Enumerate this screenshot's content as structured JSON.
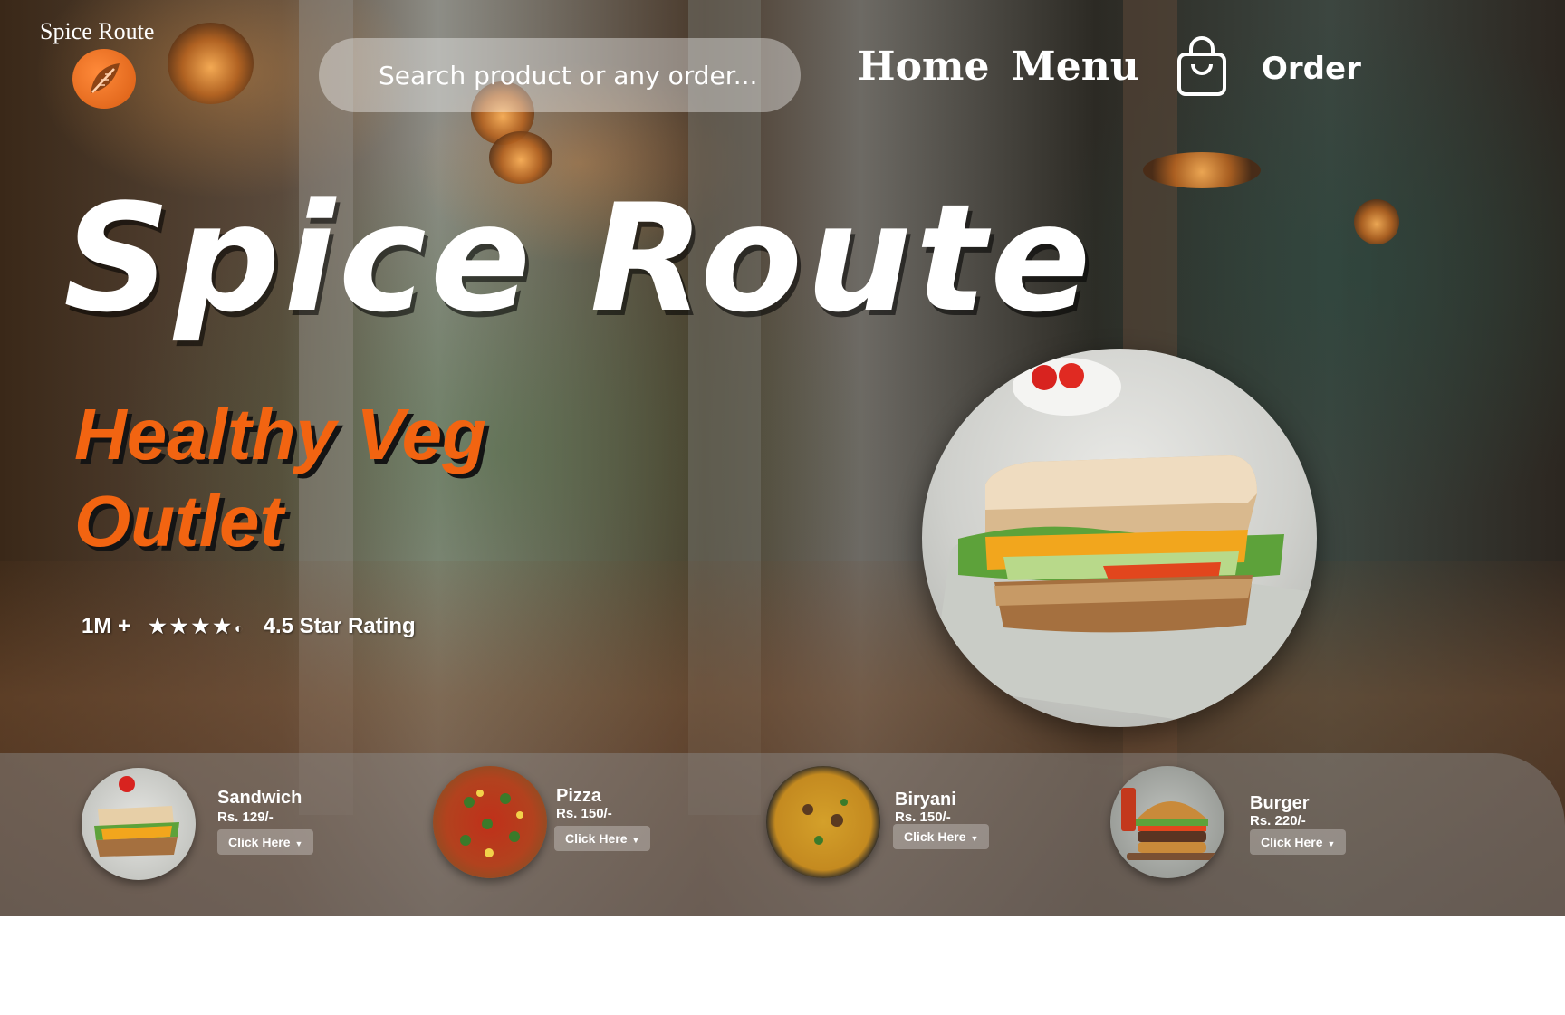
{
  "brand": {
    "name": "Spice Route",
    "logo_icon": "leaf-logo-icon"
  },
  "search": {
    "placeholder": "Search product or any order..."
  },
  "nav": {
    "home": "Home",
    "menu": "Menu",
    "order": "Order",
    "order_icon": "shopping-bag-icon"
  },
  "hero": {
    "title": "Spice Route",
    "subtitle": "Healthy Veg Outlet",
    "customers": "1M +",
    "stars": "★★★★",
    "rating_value": 4.5,
    "rating_text": "4.5 Star Rating"
  },
  "featured": {
    "item": "Sandwich"
  },
  "menu_items": [
    {
      "name": "Sandwich",
      "price": "Rs. 129/-",
      "button": "Click Here"
    },
    {
      "name": "Pizza",
      "price": "Rs. 150/-",
      "button": "Click Here"
    },
    {
      "name": "Biryani",
      "price": "Rs. 150/-",
      "button": "Click Here"
    },
    {
      "name": "Burger",
      "price": "Rs. 220/-",
      "button": "Click Here"
    }
  ],
  "colors": {
    "accent": "#f26411",
    "text": "#ffffff",
    "glass": "rgba(255,255,255,0.38)"
  }
}
